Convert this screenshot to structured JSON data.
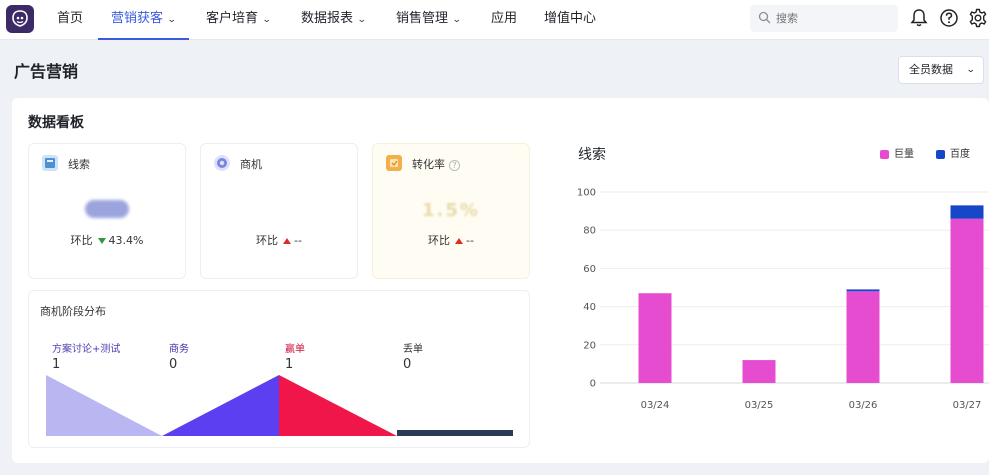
{
  "nav": {
    "items": [
      {
        "label": "首页",
        "dropdown": false,
        "active": false
      },
      {
        "label": "营销获客",
        "dropdown": true,
        "active": true
      },
      {
        "label": "客户培育",
        "dropdown": true,
        "active": false
      },
      {
        "label": "数据报表",
        "dropdown": true,
        "active": false
      },
      {
        "label": "销售管理",
        "dropdown": true,
        "active": false
      },
      {
        "label": "应用",
        "dropdown": false,
        "active": false
      },
      {
        "label": "增值中心",
        "dropdown": false,
        "active": false
      }
    ],
    "search_placeholder": "搜索",
    "icons": [
      "bell-icon",
      "help-icon",
      "settings-icon"
    ],
    "active_color": "#3b5bdb"
  },
  "page": {
    "title": "广告营销",
    "scope_select": "全员数据"
  },
  "board": {
    "title": "数据看板",
    "kpis": [
      {
        "label": "线索",
        "ratio_label": "环比",
        "trend": "down",
        "ratio_value": "43.4%",
        "icon": "leads-icon"
      },
      {
        "label": "商机",
        "ratio_label": "环比",
        "trend": "up",
        "ratio_value": "--",
        "icon": "opportunity-icon"
      },
      {
        "label": "转化率",
        "ratio_label": "环比",
        "trend": "up",
        "ratio_value": "--",
        "value": "1.5%",
        "icon": "conversion-icon"
      }
    ],
    "stages": {
      "title": "商机阶段分布",
      "items": [
        {
          "name": "方案讨论+测试",
          "count": "1",
          "color": "#b9b6f2"
        },
        {
          "name": "商务",
          "count": "0",
          "color": "#5b3ff0"
        },
        {
          "name": "赢单",
          "count": "1",
          "color": "#f0164a"
        },
        {
          "name": "丢单",
          "count": "0",
          "color": "#2b3a55"
        }
      ]
    }
  },
  "chart_data": {
    "type": "bar",
    "stacked": true,
    "title": "线索",
    "categories": [
      "03/24",
      "03/25",
      "03/26",
      "03/27"
    ],
    "series": [
      {
        "name": "巨量",
        "color": "#e64ccf",
        "values": [
          47,
          12,
          48,
          86
        ]
      },
      {
        "name": "百度",
        "color": "#1747c9",
        "values": [
          0,
          0,
          1,
          7
        ]
      }
    ],
    "ylim": [
      0,
      100
    ],
    "yticks": [
      0,
      20,
      40,
      60,
      80,
      100
    ],
    "grid": true,
    "legend": "top-right"
  }
}
